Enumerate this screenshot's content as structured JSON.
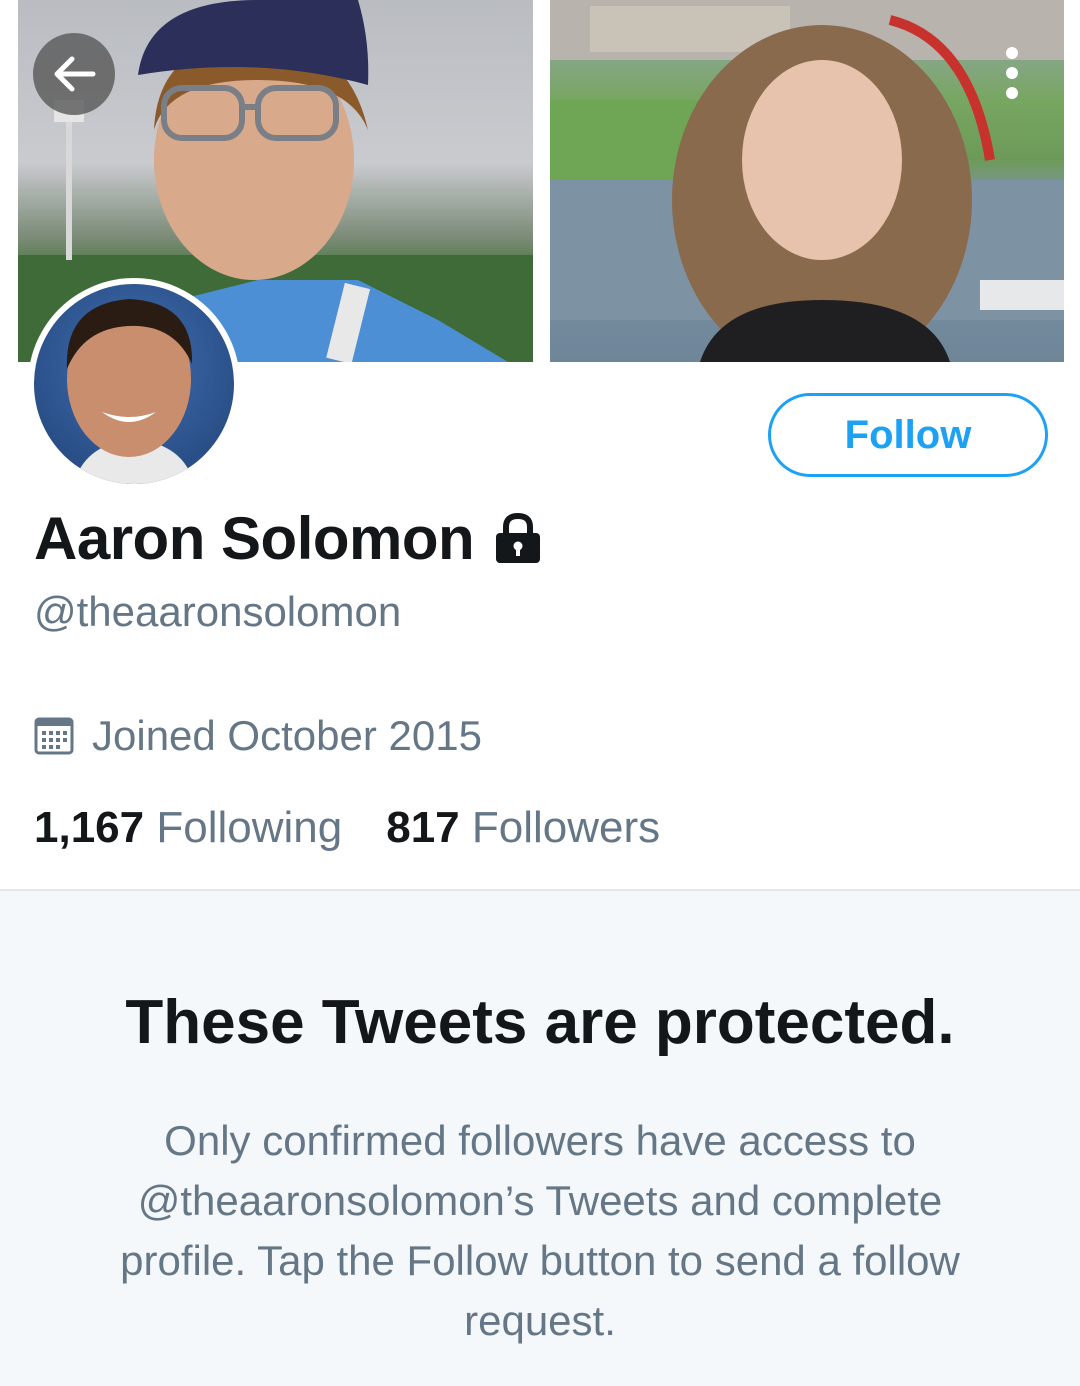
{
  "header": {
    "back_icon": "arrow-left-icon",
    "more_icon": "more-vertical-icon"
  },
  "profile": {
    "name": "Aaron Solomon",
    "lock_icon": "lock-icon",
    "handle": "@theaaronsolomon",
    "joined_icon": "calendar-icon",
    "joined": "Joined October 2015",
    "follow_label": "Follow",
    "following_count": "1,167",
    "following_label": "Following",
    "followers_count": "817",
    "followers_label": "Followers"
  },
  "protected_notice": {
    "title": "These Tweets are protected.",
    "body": "Only confirmed followers have access to @theaaronsolomon’s Tweets and complete profile. Tap the Follow button to send a follow request."
  },
  "colors": {
    "accent": "#1da1f2",
    "text_primary": "#14171a",
    "text_secondary": "#657786",
    "notice_bg": "#f5f8fa"
  }
}
